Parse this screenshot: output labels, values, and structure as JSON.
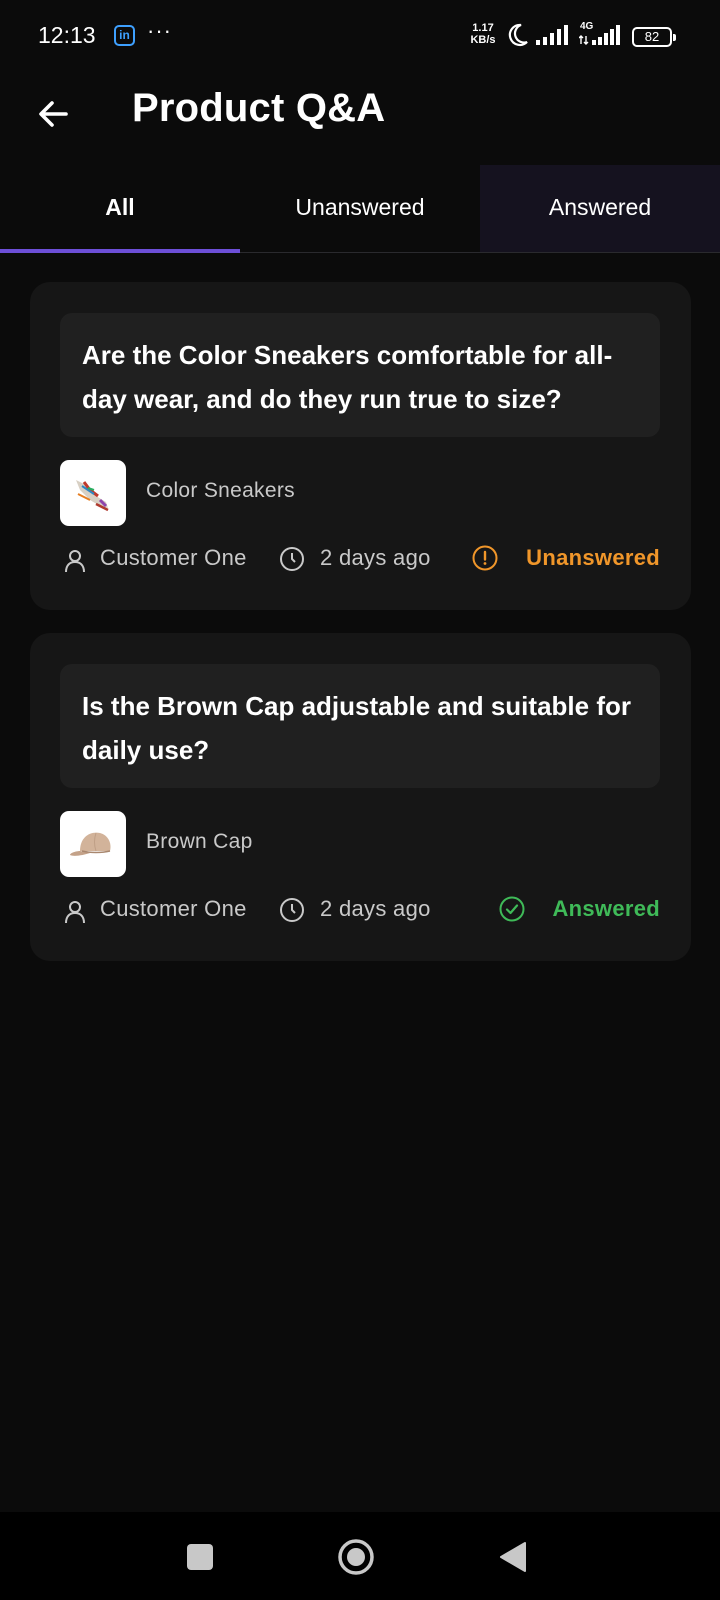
{
  "status_bar": {
    "time": "12:13",
    "app_icon": "linkedin-icon",
    "app_icon_text": "in",
    "more": "···",
    "speed_value": "1.17",
    "speed_unit": "KB/s",
    "network": "4G",
    "battery": "82"
  },
  "header": {
    "back_icon": "arrow-left-icon",
    "title": "Product Q&A"
  },
  "tabs": [
    {
      "label": "All",
      "selected": true
    },
    {
      "label": "Unanswered",
      "selected": false
    },
    {
      "label": "Answered",
      "selected": false
    }
  ],
  "questions": [
    {
      "question": "Are the Color Sneakers comfortable for all-day wear, and do they run true to size?",
      "product": "Color Sneakers",
      "customer": "Customer One",
      "time": "2 days ago",
      "status": "Unanswered",
      "status_icon": "alert-circle-icon",
      "status_color": "#f0962a"
    },
    {
      "question": "Is the Brown Cap adjustable and suitable for daily use?",
      "product": "Brown Cap",
      "customer": "Customer One",
      "time": "2 days ago",
      "status": "Answered",
      "status_icon": "check-circle-icon",
      "status_color": "#3fba58"
    }
  ],
  "colors": {
    "accent": "#6d4fd8",
    "background": "#0b0b0b",
    "card": "#161616"
  },
  "nav": {
    "recents_icon": "square-icon",
    "home_icon": "circle-home-icon",
    "back_icon": "triangle-back-icon"
  }
}
